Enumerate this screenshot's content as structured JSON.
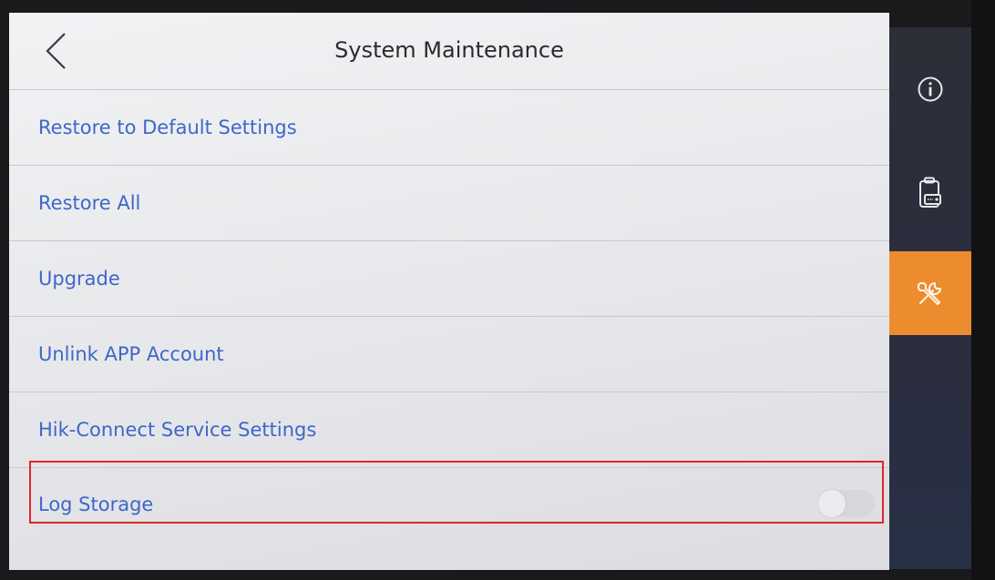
{
  "header": {
    "title": "System Maintenance"
  },
  "menu": {
    "items": [
      {
        "label": "Restore to Default Settings"
      },
      {
        "label": "Restore All"
      },
      {
        "label": "Upgrade"
      },
      {
        "label": "Unlink APP Account"
      },
      {
        "label": "Hik-Connect Service Settings"
      },
      {
        "label": "Log Storage",
        "toggle": false
      }
    ]
  },
  "sidebar": {
    "items": [
      {
        "icon": "info-icon",
        "active": false
      },
      {
        "icon": "device-icon",
        "active": false
      },
      {
        "icon": "tools-icon",
        "active": true
      }
    ]
  },
  "colors": {
    "link_text": "#3f66c9",
    "active_accent": "#ec8c2f",
    "highlight_border": "#e0262b"
  }
}
